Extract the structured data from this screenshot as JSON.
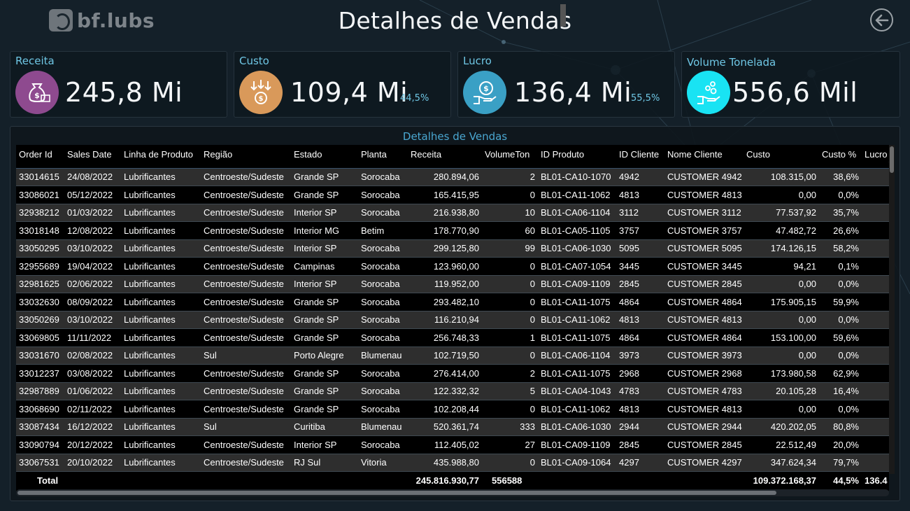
{
  "header": {
    "logo_text": "bf.lubs",
    "title": "Detalhes de Vendas",
    "back_icon": "arrow-left-circle-icon"
  },
  "kpis": [
    {
      "label": "Receita",
      "value": "245,8 Mi",
      "pct": "",
      "icon": "money-bag-icon",
      "color": "#8e4a8f"
    },
    {
      "label": "Custo",
      "value": "109,4 Mi",
      "pct": "44,5%",
      "icon": "cost-arrows-icon",
      "color": "#d9995a"
    },
    {
      "label": "Lucro",
      "value": "136,4 Mi",
      "pct": "55,5%",
      "icon": "hand-coin-icon",
      "color": "#3aa0c5"
    },
    {
      "label": "Volume Tonelada",
      "value": "556,6 Mil",
      "pct": "",
      "icon": "hand-drops-icon",
      "color": "#19e3f3"
    }
  ],
  "table": {
    "title": "Detalhes de Vendas",
    "columns": [
      "Order Id",
      "Sales Date",
      "Linha de Produto",
      "Região",
      "Estado",
      "Planta",
      "Receita",
      "VolumeTon",
      "ID Produto",
      "ID Cliente",
      "Nome Cliente",
      "Custo",
      "Custo %",
      "Lucro"
    ],
    "rows": [
      [
        "33014615",
        "24/08/2022",
        "Lubrificantes",
        "Centroeste/Sudeste",
        "Grande SP",
        "Sorocaba",
        "280.894,06",
        "2",
        "BL01-CA10-1070",
        "4942",
        "CUSTOMER 4942",
        "108.315,00",
        "38,6%",
        ""
      ],
      [
        "33086021",
        "05/12/2022",
        "Lubrificantes",
        "Centroeste/Sudeste",
        "Grande SP",
        "Sorocaba",
        "165.415,95",
        "0",
        "BL01-CA11-1062",
        "4813",
        "CUSTOMER 4813",
        "0,00",
        "0,0%",
        ""
      ],
      [
        "32938212",
        "01/03/2022",
        "Lubrificantes",
        "Centroeste/Sudeste",
        "Interior SP",
        "Sorocaba",
        "216.938,80",
        "10",
        "BL01-CA06-1104",
        "3112",
        "CUSTOMER 3112",
        "77.537,92",
        "35,7%",
        ""
      ],
      [
        "33018148",
        "12/08/2022",
        "Lubrificantes",
        "Centroeste/Sudeste",
        "Interior MG",
        "Betim",
        "178.770,90",
        "60",
        "BL01-CA05-1105",
        "3757",
        "CUSTOMER 3757",
        "47.482,72",
        "26,6%",
        ""
      ],
      [
        "33050295",
        "03/10/2022",
        "Lubrificantes",
        "Centroeste/Sudeste",
        "Interior SP",
        "Sorocaba",
        "299.125,80",
        "99",
        "BL01-CA06-1030",
        "5095",
        "CUSTOMER 5095",
        "174.126,15",
        "58,2%",
        ""
      ],
      [
        "32955689",
        "19/04/2022",
        "Lubrificantes",
        "Centroeste/Sudeste",
        "Campinas",
        "Sorocaba",
        "123.960,00",
        "0",
        "BL01-CA07-1054",
        "3445",
        "CUSTOMER 3445",
        "94,21",
        "0,1%",
        ""
      ],
      [
        "32981625",
        "02/06/2022",
        "Lubrificantes",
        "Centroeste/Sudeste",
        "Interior SP",
        "Sorocaba",
        "119.952,00",
        "0",
        "BL01-CA09-1109",
        "2845",
        "CUSTOMER 2845",
        "0,00",
        "0,0%",
        ""
      ],
      [
        "33032630",
        "08/09/2022",
        "Lubrificantes",
        "Centroeste/Sudeste",
        "Grande SP",
        "Sorocaba",
        "293.482,10",
        "0",
        "BL01-CA11-1075",
        "4864",
        "CUSTOMER 4864",
        "175.905,15",
        "59,9%",
        ""
      ],
      [
        "33050269",
        "03/10/2022",
        "Lubrificantes",
        "Centroeste/Sudeste",
        "Grande SP",
        "Sorocaba",
        "116.210,94",
        "0",
        "BL01-CA11-1062",
        "4813",
        "CUSTOMER 4813",
        "0,00",
        "0,0%",
        ""
      ],
      [
        "33069805",
        "11/11/2022",
        "Lubrificantes",
        "Centroeste/Sudeste",
        "Grande SP",
        "Sorocaba",
        "256.748,33",
        "1",
        "BL01-CA11-1075",
        "4864",
        "CUSTOMER 4864",
        "153.100,00",
        "59,6%",
        ""
      ],
      [
        "33031670",
        "02/08/2022",
        "Lubrificantes",
        "Sul",
        "Porto Alegre",
        "Blumenau",
        "102.719,50",
        "0",
        "BL01-CA06-1104",
        "3973",
        "CUSTOMER 3973",
        "0,00",
        "0,0%",
        ""
      ],
      [
        "33012237",
        "03/08/2022",
        "Lubrificantes",
        "Centroeste/Sudeste",
        "Grande SP",
        "Sorocaba",
        "276.414,00",
        "2",
        "BL01-CA11-1075",
        "2968",
        "CUSTOMER 2968",
        "173.980,58",
        "62,9%",
        ""
      ],
      [
        "32987889",
        "01/06/2022",
        "Lubrificantes",
        "Centroeste/Sudeste",
        "Grande SP",
        "Sorocaba",
        "122.332,32",
        "5",
        "BL01-CA04-1043",
        "4783",
        "CUSTOMER 4783",
        "20.105,28",
        "16,4%",
        ""
      ],
      [
        "33068690",
        "02/11/2022",
        "Lubrificantes",
        "Centroeste/Sudeste",
        "Grande SP",
        "Sorocaba",
        "102.208,44",
        "0",
        "BL01-CA11-1062",
        "4813",
        "CUSTOMER 4813",
        "0,00",
        "0,0%",
        ""
      ],
      [
        "33087434",
        "16/12/2022",
        "Lubrificantes",
        "Sul",
        "Curitiba",
        "Blumenau",
        "520.361,74",
        "333",
        "BL01-CA06-1030",
        "2944",
        "CUSTOMER 2944",
        "420.202,05",
        "80,8%",
        ""
      ],
      [
        "33090794",
        "20/12/2022",
        "Lubrificantes",
        "Centroeste/Sudeste",
        "Interior SP",
        "Sorocaba",
        "112.405,02",
        "27",
        "BL01-CA09-1109",
        "2845",
        "CUSTOMER 2845",
        "22.512,49",
        "20,0%",
        ""
      ],
      [
        "33067531",
        "20/10/2022",
        "Lubrificantes",
        "Centroeste/Sudeste",
        "RJ Sul",
        "Vitoria",
        "435.988,80",
        "0",
        "BL01-CA09-1064",
        "4297",
        "CUSTOMER 4297",
        "347.624,34",
        "79,7%",
        ""
      ]
    ],
    "total": {
      "label": "Total",
      "receita": "245.816.930,77",
      "volume": "556588",
      "custo": "109.372.168,37",
      "custo_pct": "44,5%",
      "lucro": "136.4"
    }
  }
}
